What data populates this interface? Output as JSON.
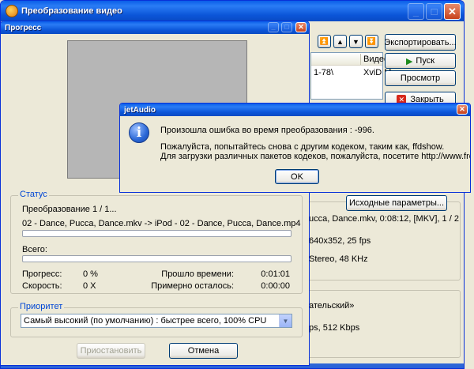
{
  "main_window": {
    "title": "Преобразование видео",
    "side_buttons": {
      "export": "Экспортировать...",
      "start": "Пуск",
      "preview": "Просмотр",
      "close": "Закрыть",
      "source_params": "Исходные параметры..."
    },
    "list": {
      "header_video": "Видео",
      "row_cell1": "1-78\\",
      "row_cell2": "XviD M"
    },
    "info_lines": [
      "ucca, Dance.mkv, 0:08:12, [MKV], 1 / 2",
      "640x352, 25 fps",
      "Stereo, 48 KHz",
      "ательский»",
      "ps, 512 Kbps"
    ]
  },
  "progress_dialog": {
    "title": "Прогресс",
    "status": {
      "group_label": "Статус",
      "converting": "Преобразование 1 / 1...",
      "file_line": "02 - Dance, Pucca, Dance.mkv -> iPod - 02 - Dance, Pucca, Dance.mp4",
      "file_progress_fraction": 0.0,
      "total_label": "Всего:",
      "total_progress_fraction": 0.0,
      "progress_label": "Прогресс:",
      "progress_value": "0 %",
      "speed_label": "Скорость:",
      "speed_value": "0 X",
      "elapsed_label": "Прошло времени:",
      "elapsed_value": "0:01:01",
      "remaining_label": "Примерно осталось:",
      "remaining_value": "0:00:00"
    },
    "priority": {
      "group_label": "Приоритет",
      "selected": "Самый высокий (по умолчанию) : быстрее всего, 100% CPU"
    },
    "pause_button": "Приостановить",
    "cancel_button": "Отмена"
  },
  "error_dialog": {
    "title": "jetAudio",
    "message_line1": "Произошла ошибка во время преобразования : -996.",
    "message_line2": "Пожалуйста, попытайтесь снова с другим кодеком, таким как, ffdshow.",
    "message_line3": "Для загрузки различных пакетов кодеков, пожалуйста, посетите http://www.free-codecs.com",
    "ok_button": "OK",
    "info_icon_glyph": "i"
  },
  "colors": {
    "title_blue": "#0b55d8",
    "group_label_blue": "#0046d5",
    "progress_green": "#3ab54a",
    "info_icon_blue": "#2a67d6"
  }
}
